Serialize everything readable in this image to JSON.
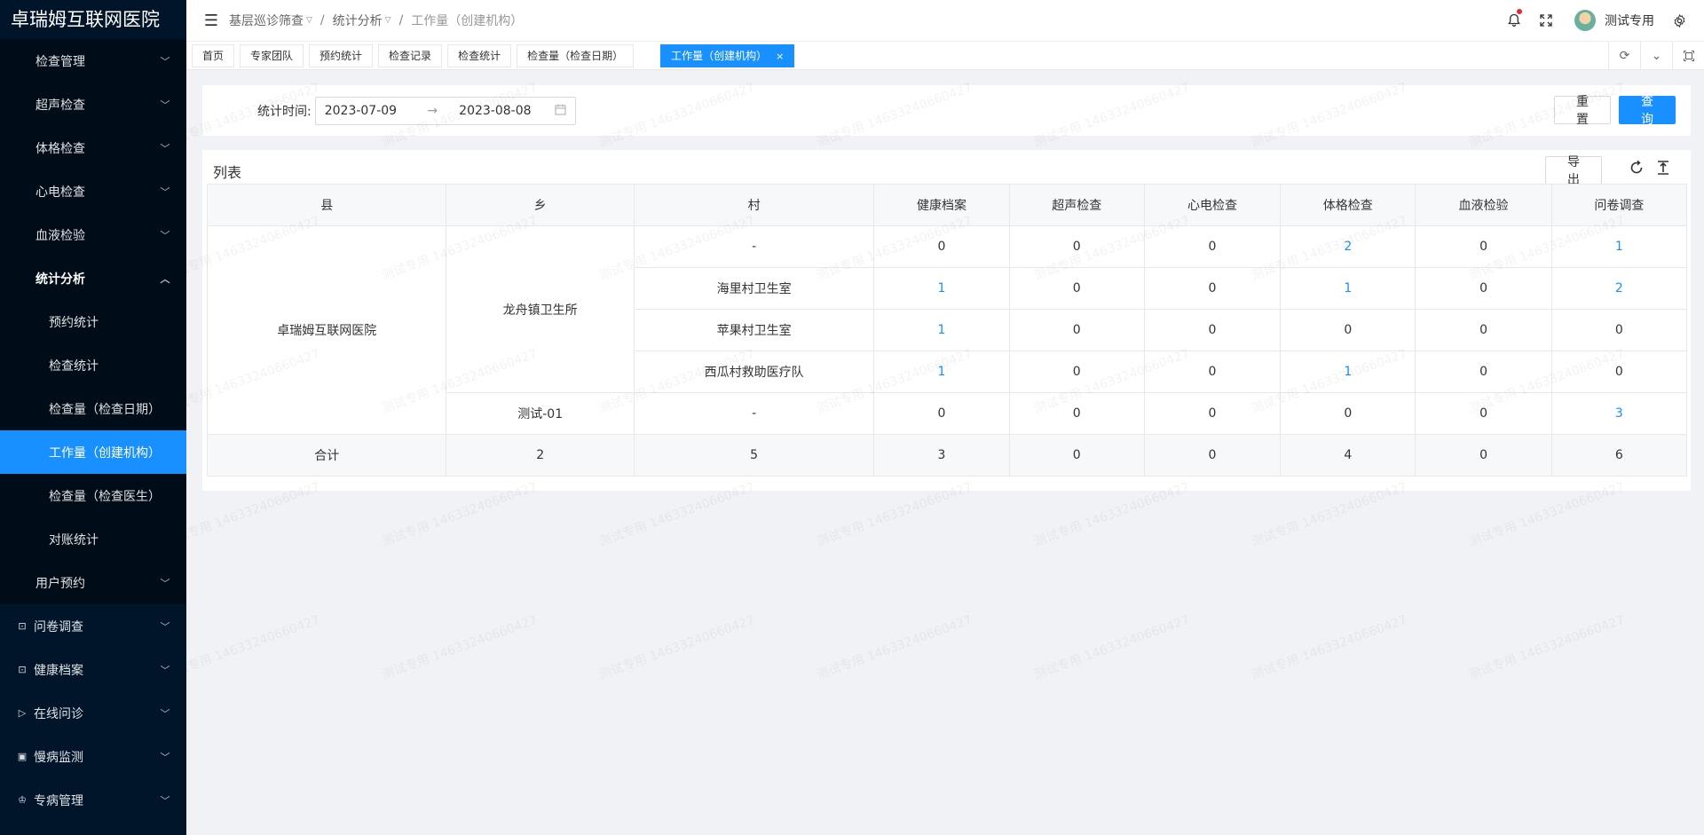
{
  "app": {
    "title": "卓瑞姆互联网医院"
  },
  "sidebar": {
    "menus": [
      {
        "label": "检查管理"
      },
      {
        "label": "超声检查"
      },
      {
        "label": "体格检查"
      },
      {
        "label": "心电检查"
      },
      {
        "label": "血液检验"
      }
    ],
    "stats_parent": {
      "label": "统计分析"
    },
    "stats_children": [
      {
        "label": "预约统计"
      },
      {
        "label": "检查统计"
      },
      {
        "label": "检查量（检查日期）"
      },
      {
        "label": "工作量（创建机构）"
      },
      {
        "label": "检查量（检查医生）"
      },
      {
        "label": "对账统计"
      }
    ],
    "user_booking": {
      "label": "用户预约"
    },
    "top_menus": [
      {
        "label": "问卷调查",
        "icon": "form-icon"
      },
      {
        "label": "健康档案",
        "icon": "profile-icon"
      },
      {
        "label": "在线问诊",
        "icon": "send-icon"
      },
      {
        "label": "慢病监测",
        "icon": "monitor-icon"
      },
      {
        "label": "专病管理",
        "icon": "crown-icon"
      }
    ]
  },
  "header": {
    "breadcrumb": [
      "基层巡诊筛查",
      "统计分析",
      "工作量（创建机构）"
    ],
    "username": "测试专用"
  },
  "tabs": [
    {
      "label": "首页"
    },
    {
      "label": "专家团队"
    },
    {
      "label": "预约统计"
    },
    {
      "label": "检查记录"
    },
    {
      "label": "检查统计"
    },
    {
      "label": "检查量（检查日期）"
    }
  ],
  "active_tab": {
    "label": "工作量（创建机构）",
    "close": "×"
  },
  "search": {
    "label": "统计时间:",
    "start_date": "2023-07-09",
    "end_date": "2023-08-08",
    "arrow": "→",
    "reset_label": "重 置",
    "query_label": "查 询"
  },
  "list": {
    "title": "列表",
    "export_label": "导 出",
    "columns": [
      "县",
      "乡",
      "村",
      "健康档案",
      "超声检查",
      "心电检查",
      "体格检查",
      "血液检验",
      "问卷调查"
    ],
    "county": "卓瑞姆互联网医院",
    "towns": [
      "龙舟镇卫生所",
      "测试-01"
    ],
    "rows": [
      {
        "village": "-",
        "values": [
          "0",
          "0",
          "0",
          "2",
          "0",
          "1"
        ]
      },
      {
        "village": "海里村卫生室",
        "values": [
          "1",
          "0",
          "0",
          "1",
          "0",
          "2"
        ]
      },
      {
        "village": "苹果村卫生室",
        "values": [
          "1",
          "0",
          "0",
          "0",
          "0",
          "0"
        ]
      },
      {
        "village": "西瓜村救助医疗队",
        "values": [
          "1",
          "0",
          "0",
          "1",
          "0",
          "0"
        ]
      },
      {
        "village": "-",
        "values": [
          "0",
          "0",
          "0",
          "0",
          "0",
          "3"
        ]
      }
    ],
    "total": {
      "label": "合计",
      "town_count": "2",
      "village_count": "5",
      "values": [
        "3",
        "0",
        "0",
        "4",
        "0",
        "6"
      ]
    }
  },
  "watermark": "测试专用 14633240660427"
}
